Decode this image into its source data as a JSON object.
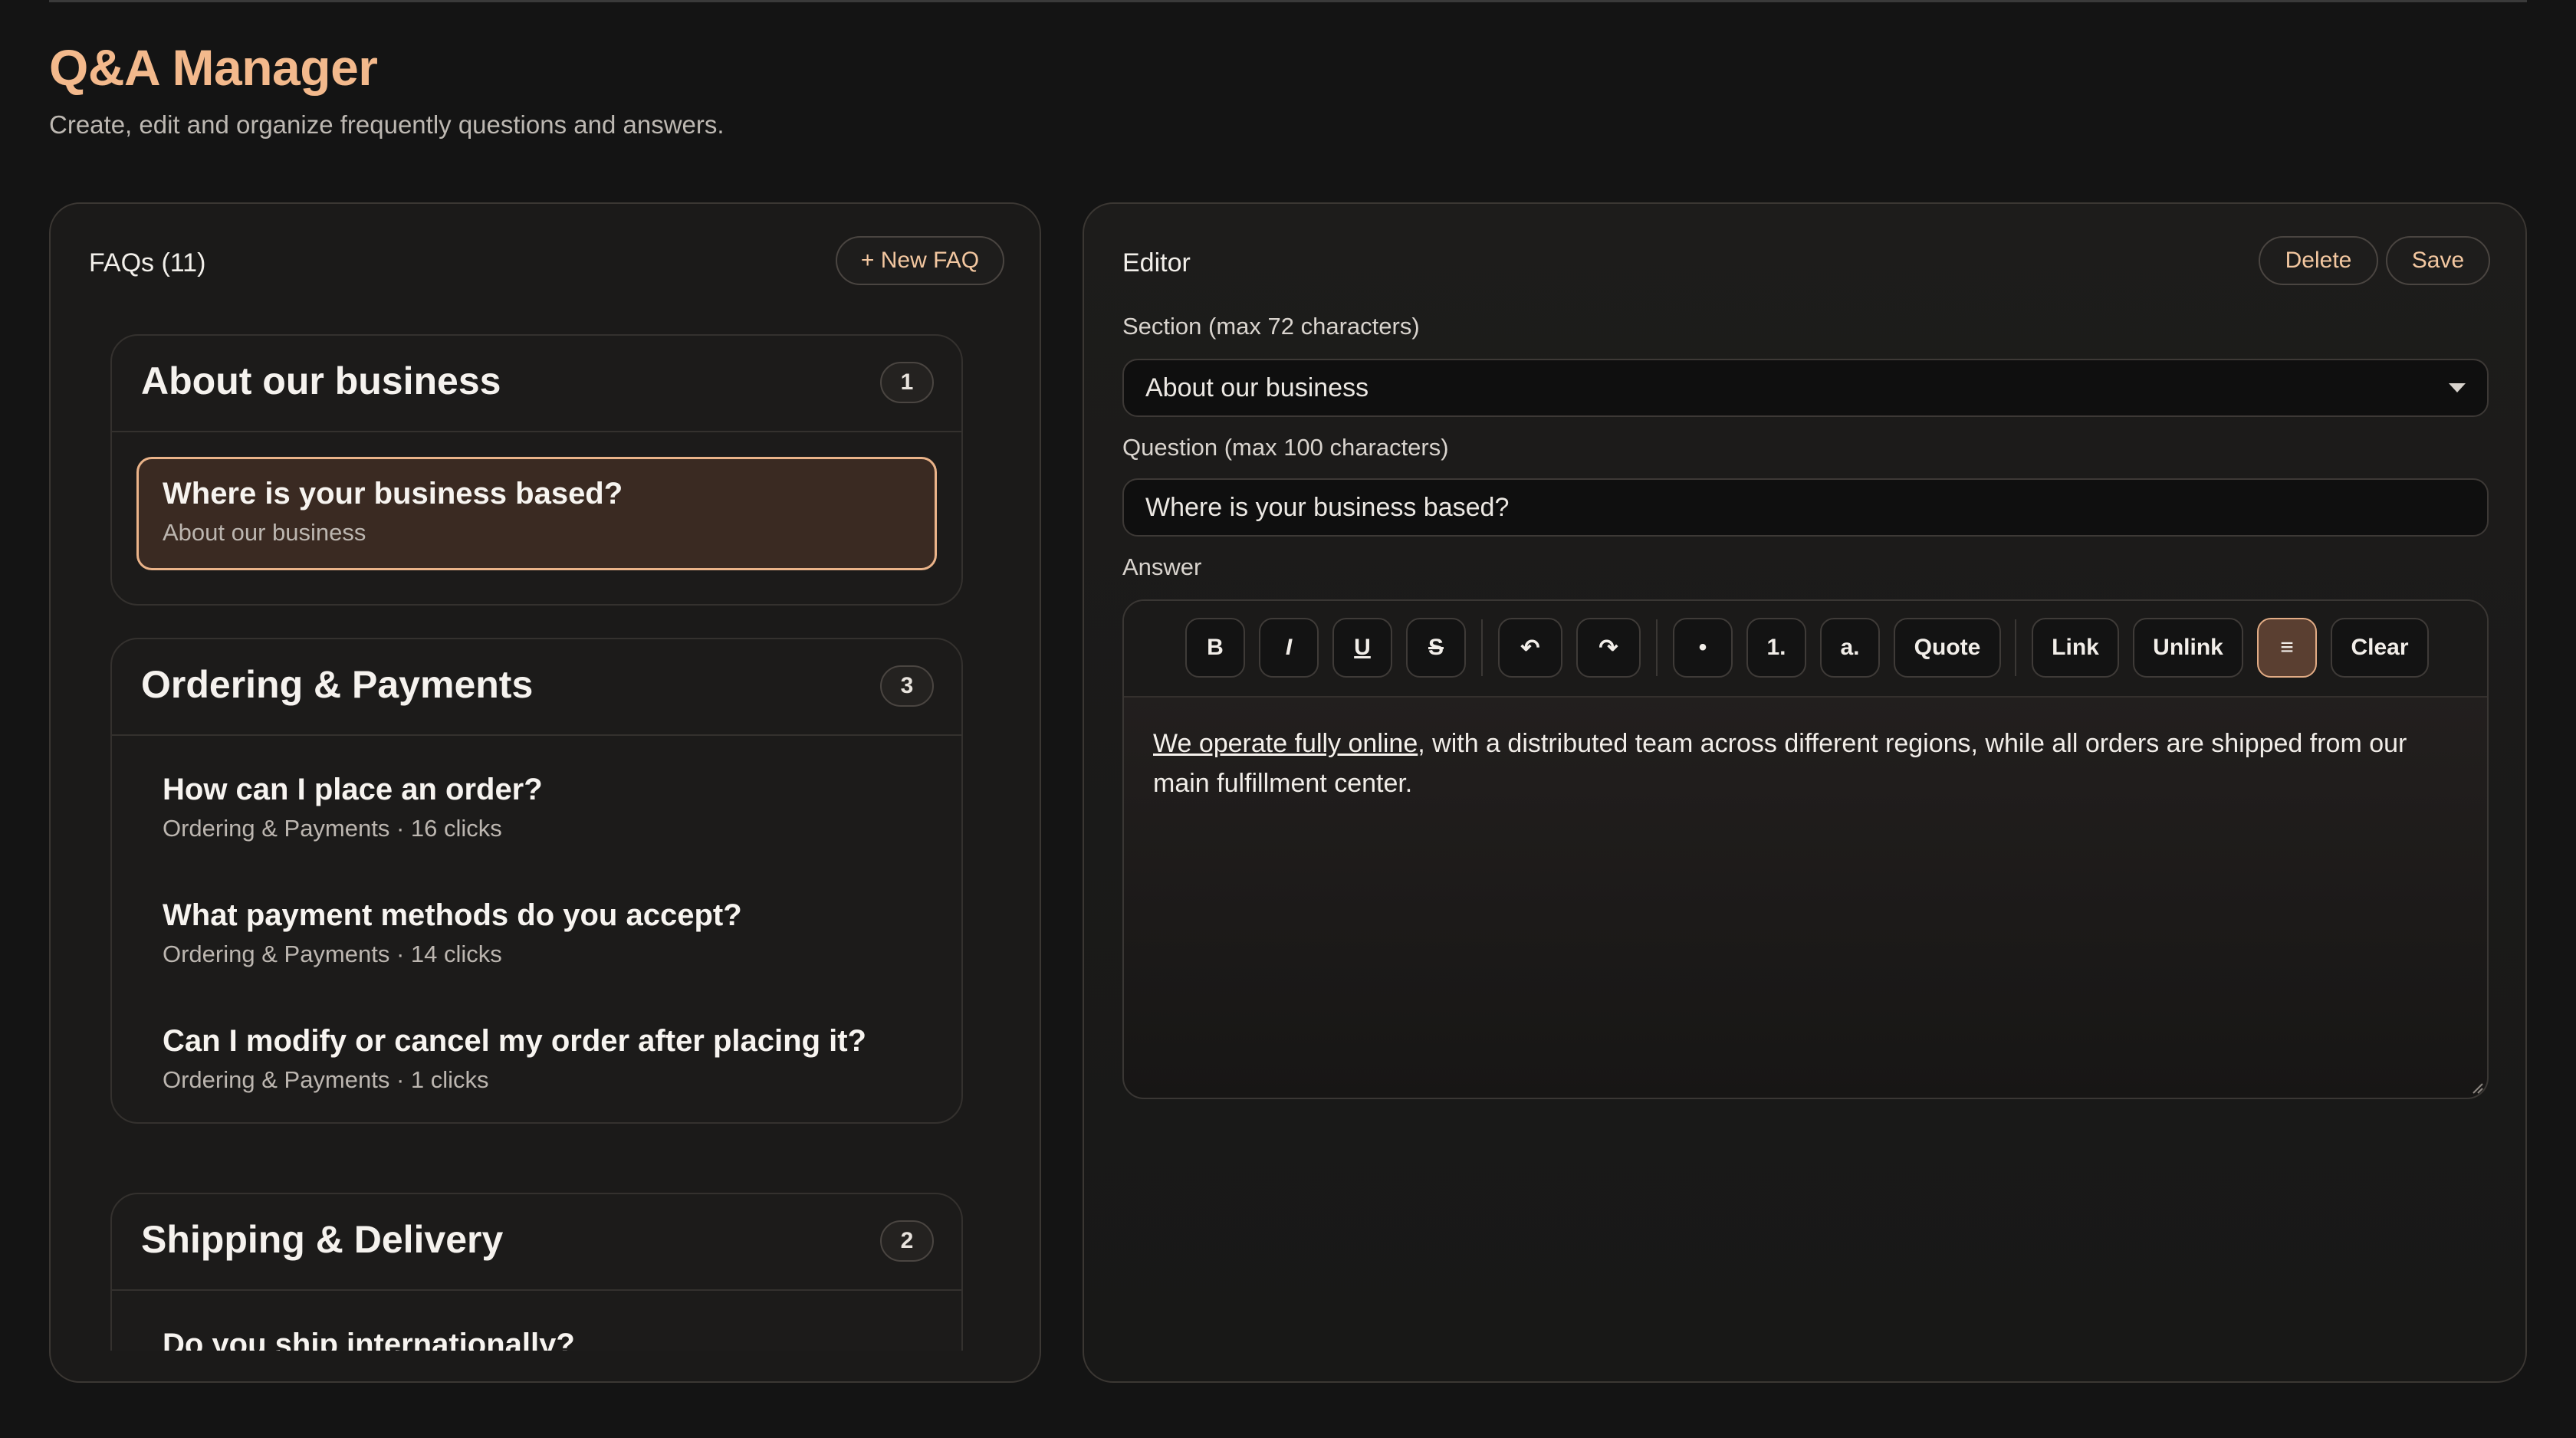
{
  "header": {
    "title": "Q&A Manager",
    "subtitle": "Create, edit and organize frequently questions and answers."
  },
  "faq_panel": {
    "title": "FAQs (11)",
    "new_button": "+ New FAQ",
    "sections": [
      {
        "title": "About our business",
        "count": "1",
        "items": [
          {
            "question": "Where is your business based?",
            "meta": "About our business",
            "active": true
          }
        ]
      },
      {
        "title": "Ordering & Payments",
        "count": "3",
        "items": [
          {
            "question": "How can I place an order?",
            "meta": "Ordering & Payments · 16 clicks"
          },
          {
            "question": "What payment methods do you accept?",
            "meta": "Ordering & Payments · 14 clicks"
          },
          {
            "question": "Can I modify or cancel my order after placing it?",
            "meta": "Ordering & Payments · 1 clicks"
          }
        ]
      },
      {
        "title": "Shipping & Delivery",
        "count": "2",
        "items": [
          {
            "question": "Do you ship internationally?",
            "meta": ""
          }
        ]
      }
    ]
  },
  "editor": {
    "title": "Editor",
    "delete_label": "Delete",
    "save_label": "Save",
    "section_label": "Section (max 72 characters)",
    "section_value": "About our business",
    "question_label": "Question (max 100 characters)",
    "question_value": "Where is your business based?",
    "answer_label": "Answer",
    "toolbar": {
      "bold": "B",
      "italic": "I",
      "underline": "U",
      "strike": "S",
      "undo": "↶",
      "redo": "↷",
      "bullet": "•",
      "numbered": "1.",
      "alpha": "a.",
      "quote": "Quote",
      "link": "Link",
      "unlink": "Unlink",
      "align": "≡",
      "clear": "Clear"
    },
    "answer": {
      "link_text": "We operate fully online",
      "rest_text": ", with a distributed team across different regions, while all orders are shipped from our main fulfillment center."
    }
  },
  "colors": {
    "accent": "#f3b98c",
    "background": "#141414",
    "active_item_border": "#eab389"
  }
}
